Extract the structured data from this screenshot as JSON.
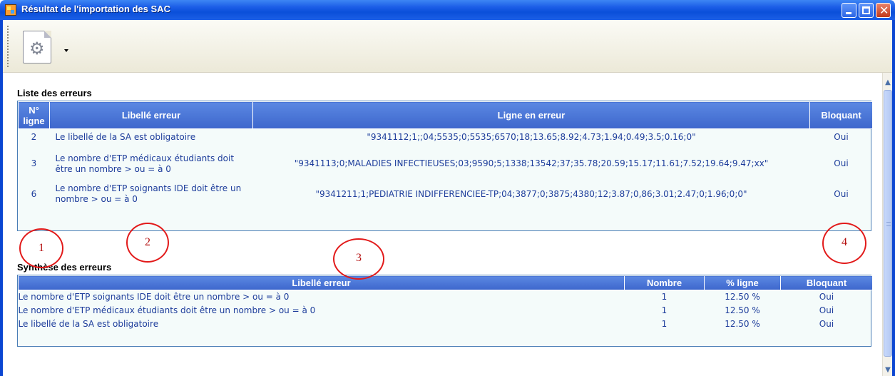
{
  "window": {
    "title": "Résultat de l'importation des SAC"
  },
  "toolbar": {
    "doc_button_icon": "gear-icon"
  },
  "errors_list": {
    "title": "Liste des erreurs",
    "columns": {
      "line_no": "N° ligne",
      "label": "Libellé erreur",
      "line": "Ligne en erreur",
      "blocking": "Bloquant"
    },
    "rows": [
      {
        "line_no": "2",
        "label": "Le libellé de la SA est obligatoire",
        "line": "\"9341112;1;;04;5535;0;5535;6570;18;13.65;8.92;4.73;1.94;0.49;3.5;0.16;0\"",
        "blocking": "Oui"
      },
      {
        "line_no": "3",
        "label": "Le nombre d'ETP médicaux étudiants doit être un nombre > ou = à 0",
        "line": "\"9341113;0;MALADIES INFECTIEUSES;03;9590;5;1338;13542;37;35.78;20.59;15.17;11.61;7.52;19.64;9.47;xx\"",
        "blocking": "Oui"
      },
      {
        "line_no": "6",
        "label": "Le nombre d'ETP soignants IDE doit être un nombre > ou = à 0",
        "line": "\"9341211;1;PEDIATRIE INDIFFERENCIEE-TP;04;3877;0;3875;4380;12;3.87;0,86;3.01;2.47;0;1.96;0;0\"",
        "blocking": "Oui"
      }
    ]
  },
  "errors_synthesis": {
    "title": "Synthèse des erreurs",
    "columns": {
      "label": "Libellé erreur",
      "count": "Nombre",
      "pct": "% ligne",
      "blocking": "Bloquant"
    },
    "rows": [
      {
        "label": "Le nombre d'ETP soignants IDE doit être un nombre > ou = à 0",
        "count": "1",
        "pct": "12.50 %",
        "blocking": "Oui"
      },
      {
        "label": "Le nombre d'ETP médicaux étudiants doit être un nombre > ou = à 0",
        "count": "1",
        "pct": "12.50 %",
        "blocking": "Oui"
      },
      {
        "label": "Le libellé de la SA est obligatoire",
        "count": "1",
        "pct": "12.50 %",
        "blocking": "Oui"
      }
    ]
  },
  "annotations": [
    "1",
    "2",
    "3",
    "4"
  ],
  "colors": {
    "title_bar": "#0a4fd9",
    "header_bg": "#3d66cc",
    "cell_text": "#1d3d9b",
    "annotation": "#e21a1a"
  }
}
